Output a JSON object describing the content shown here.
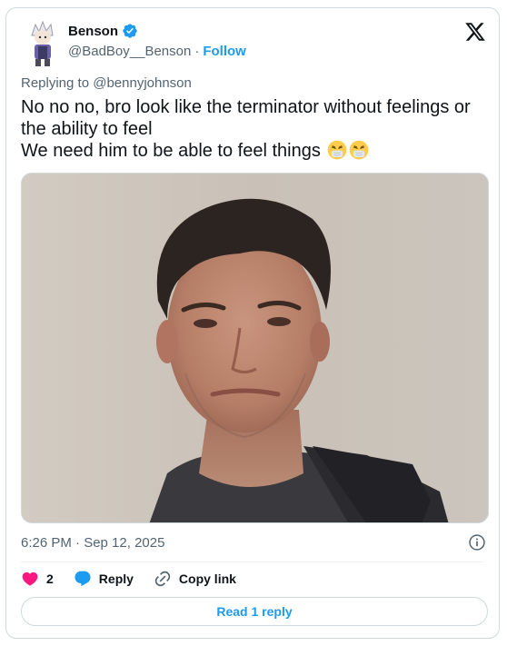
{
  "author": {
    "display_name": "Benson",
    "handle": "@BadBoy__Benson",
    "separator": "·",
    "follow_label": "Follow",
    "verified_color": "#1d9bf0"
  },
  "reply_context": {
    "prefix": "Replying to",
    "mention": "@bennyjohnson"
  },
  "tweet": {
    "text": "No no no, bro look like the terminator without feelings or the ability to feel\nWe need him to be able to feel things",
    "emojis": [
      "sneezing-face",
      "sneezing-face"
    ]
  },
  "meta": {
    "timestamp": "6:26 PM · Sep 12, 2025"
  },
  "actions": {
    "like_count": "2",
    "reply_label": "Reply",
    "copy_link_label": "Copy link"
  },
  "footer": {
    "read_replies_label": "Read 1 reply"
  },
  "colors": {
    "accent": "#1d9bf0",
    "like": "#f91880",
    "text_secondary": "#536471",
    "border": "#cfd9de"
  },
  "icons": [
    "verified-badge-icon",
    "x-logo-icon",
    "info-icon",
    "heart-icon",
    "reply-bubble-icon",
    "link-icon"
  ]
}
